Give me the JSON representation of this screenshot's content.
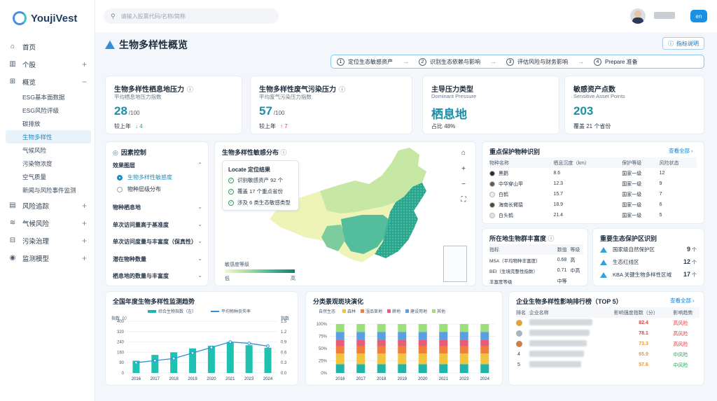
{
  "app": {
    "name": "YoujiVest"
  },
  "sidebar": {
    "items": [
      {
        "label": "首页",
        "icon": "home-icon",
        "glyph": "⌂",
        "expand": ""
      },
      {
        "label": "个股",
        "icon": "stock-chart-icon",
        "glyph": "▥",
        "expand": "+"
      },
      {
        "label": "概览",
        "icon": "overview-grid-icon",
        "glyph": "⊞",
        "expand": "−"
      }
    ],
    "subitems": [
      "ESG基本面数据",
      "ESG风险评级",
      "碳排放",
      "生物多样性",
      "气候风险",
      "污染物浓度",
      "空气质量",
      "新闻与风险事件监测"
    ],
    "items2": [
      {
        "label": "风险追踪",
        "icon": "risk-track-icon",
        "glyph": "▤",
        "expand": "+"
      },
      {
        "label": "气候风险",
        "icon": "wind-icon",
        "glyph": "≋",
        "expand": "+"
      },
      {
        "label": "污染治理",
        "icon": "pollution-icon",
        "glyph": "⊟",
        "expand": "+"
      },
      {
        "label": "监测模型",
        "icon": "model-icon",
        "glyph": "◉",
        "expand": "+"
      }
    ]
  },
  "topbar": {
    "search_placeholder": "请输入股票代码/名称/简称",
    "lang": "en"
  },
  "page": {
    "title": "生物多样性概览",
    "help": "指标说明"
  },
  "steps": [
    {
      "num": "1",
      "label": "定位生态敏感资产"
    },
    {
      "num": "2",
      "label": "识别生态依赖与影响"
    },
    {
      "num": "3",
      "label": "评估风险与财务影响"
    },
    {
      "num": "4",
      "label": "Prepare 准备"
    }
  ],
  "kpis": [
    {
      "title": "生物多样性栖息地压力",
      "sub": "平均栖息地压力指数",
      "value": "28",
      "unit": "/100",
      "cmp": "较上年",
      "delta": "↓ 4",
      "dir": "dn"
    },
    {
      "title": "生物多样性废气污染压力",
      "sub": "平均废气污染压力指数",
      "value": "57",
      "unit": "/100",
      "cmp": "较上年",
      "delta": "↑ 7",
      "dir": "up"
    },
    {
      "title": "主导压力类型",
      "sub": "Dominant Pressure",
      "value": "栖息地",
      "unit": "",
      "cmp": "占比 48%",
      "delta": "",
      "dir": ""
    },
    {
      "title": "敏感资产点数",
      "sub": "Sensitive Asset Points",
      "value": "203",
      "unit": "",
      "cmp": "覆盖 21 个省份",
      "delta": "",
      "dir": ""
    }
  ],
  "filters": {
    "title": "因素控制",
    "group": "效果图层",
    "radios": [
      "生物多样性敏感度",
      "物种层级分布"
    ],
    "rows": [
      "物种栖息地",
      "单次访问量高于基准度",
      "单次访问度量与丰富度（保真性）",
      "潜在物种数量",
      "栖息地的数量与丰富度"
    ]
  },
  "map": {
    "title": "生物多样性敏感分布",
    "locate_title": "Locate 定位结果",
    "locate_lines": [
      "识别敏感资产 92 个",
      "覆盖 17 个重点省份",
      "涉及 6 类生态敏感类型"
    ],
    "legend_title": "敏感度等级",
    "legend_low": "低",
    "legend_high": "高",
    "zoom_in": "+",
    "zoom_out": "−"
  },
  "species": {
    "title": "重点保护物种识别",
    "view_all": "查看全部 ›",
    "headers": [
      "物种名称",
      "栖息沉度（km）",
      "保护等级",
      "风险状态"
    ],
    "rows": [
      {
        "name": "黑鹳",
        "dist": "8.6",
        "level": "国家一级",
        "risk": "12"
      },
      {
        "name": "中华穿山甲",
        "dist": "12.3",
        "level": "国家一级",
        "risk": "9"
      },
      {
        "name": "白鹤",
        "dist": "15.7",
        "level": "国家一级",
        "risk": "7"
      },
      {
        "name": "海南长臂猿",
        "dist": "18.9",
        "level": "国家一级",
        "risk": "6"
      },
      {
        "name": "白头鹤",
        "dist": "21.4",
        "level": "国家一级",
        "risk": "5"
      }
    ]
  },
  "richness": {
    "title": "所在地生物群丰富度",
    "headers": [
      "指标",
      "数值",
      "等级"
    ],
    "rows": [
      {
        "k": "MSA（平均物种丰富度）",
        "v": "0.68",
        "g": "高"
      },
      {
        "k": "BEI（生境完整性指数）",
        "v": "0.71",
        "g": "中高"
      },
      {
        "k": "丰富度等级",
        "v": "中等",
        "g": ""
      }
    ]
  },
  "protected": {
    "title": "重要生态保护区识别",
    "rows": [
      {
        "k": "国家级自然保护区",
        "n": "9",
        "u": "个"
      },
      {
        "k": "生态红线区",
        "n": "12",
        "u": "个"
      },
      {
        "k": "KBA 关键生物多样性区域",
        "n": "17",
        "u": "个"
      }
    ]
  },
  "ranking": {
    "title": "企业生物多样性影响排行榜（TOP 5）",
    "view_all": "查看全部 ›",
    "headers": [
      "排名",
      "企业名称",
      "影响强度指数（分）",
      "影响趋势"
    ],
    "rows": [
      {
        "rank": "1",
        "score": "82.4",
        "trend": "高风险",
        "cls": "risk-h",
        "medal": "#e0a53a"
      },
      {
        "rank": "2",
        "score": "78.1",
        "trend": "高风险",
        "cls": "risk-h",
        "medal": "#a9b4c0"
      },
      {
        "rank": "3",
        "score": "73.3",
        "trend": "高风险",
        "cls": "risk-h",
        "medal": "#c9804a"
      },
      {
        "rank": "4",
        "score": "65.9",
        "trend": "中风险",
        "cls": "risk-m",
        "medal": ""
      },
      {
        "rank": "5",
        "score": "57.6",
        "trend": "中风险",
        "cls": "risk-m",
        "medal": ""
      }
    ]
  },
  "colors": {
    "accent": "#1b8fc5",
    "teal": "#1fb5a8",
    "line": "#2f8fdc"
  },
  "chart_data": [
    {
      "type": "bar",
      "title": "全国年度生物多样性监测趋势",
      "ylabel": "指数（t）",
      "y2label": "指数",
      "categories": [
        "2016",
        "2017",
        "2018",
        "2019",
        "2020",
        "2021",
        "2023",
        "2024"
      ],
      "series": [
        {
          "name": "综合生物指数（左）",
          "type": "bar",
          "values": [
            95,
            140,
            160,
            190,
            210,
            240,
            215,
            195
          ]
        },
        {
          "name": "平均物种丧失率",
          "type": "line",
          "axis": "right",
          "values": [
            0.3,
            0.36,
            0.42,
            0.58,
            0.74,
            0.9,
            0.86,
            0.78
          ]
        }
      ],
      "ylim": [
        0,
        400
      ],
      "y2lim": [
        0,
        1.5
      ],
      "yticks": [
        0,
        80,
        160,
        240,
        320,
        400
      ],
      "y2ticks": [
        0.0,
        0.3,
        0.6,
        0.9,
        1.2,
        1.5
      ]
    },
    {
      "type": "bar",
      "title": "分类景观斑块演化",
      "categories": [
        "2016",
        "2017",
        "2018",
        "2019",
        "2020",
        "2021",
        "2023",
        "2024"
      ],
      "series": [
        {
          "name": "自然生态",
          "color": "#1fb5a8",
          "values": [
            0.18,
            0.18,
            0.18,
            0.18,
            0.18,
            0.18,
            0.18,
            0.18
          ]
        },
        {
          "name": "森林",
          "color": "#f2c43d",
          "values": [
            0.22,
            0.22,
            0.22,
            0.22,
            0.22,
            0.22,
            0.22,
            0.22
          ]
        },
        {
          "name": "湿品草地",
          "color": "#f07f3c",
          "values": [
            0.15,
            0.15,
            0.15,
            0.15,
            0.15,
            0.15,
            0.15,
            0.15
          ]
        },
        {
          "name": "耕地",
          "color": "#e85c7a",
          "values": [
            0.13,
            0.13,
            0.13,
            0.13,
            0.13,
            0.13,
            0.13,
            0.13
          ]
        },
        {
          "name": "建设用地",
          "color": "#5a9fe0",
          "values": [
            0.16,
            0.16,
            0.16,
            0.16,
            0.16,
            0.16,
            0.16,
            0.16
          ]
        },
        {
          "name": "其他",
          "color": "#9be07a",
          "values": [
            0.16,
            0.16,
            0.16,
            0.16,
            0.16,
            0.16,
            0.16,
            0.16
          ]
        }
      ],
      "yticks": [
        "0%",
        "25%",
        "50%",
        "75%",
        "100%"
      ],
      "stacked": true
    }
  ]
}
